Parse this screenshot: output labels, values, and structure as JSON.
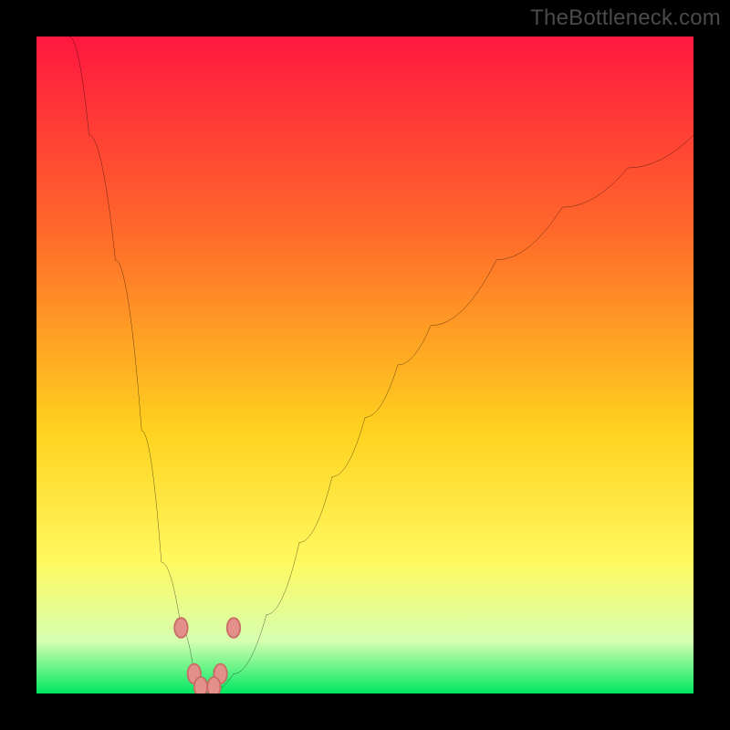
{
  "watermark": "TheBottleneck.com",
  "colors": {
    "page_bg": "#000000",
    "gradient_top": "#ff173f",
    "gradient_mid1": "#ff6a2a",
    "gradient_mid2": "#ffd21f",
    "gradient_mid3": "#fff960",
    "gradient_bottom_light": "#d6ffb0",
    "gradient_bottom": "#00e862",
    "curve": "#000000",
    "marker_fill": "#e4908a",
    "marker_stroke": "#c86b64",
    "watermark": "#4a4a4a"
  },
  "chart_data": {
    "type": "line",
    "title": "",
    "xlabel": "",
    "ylabel": "",
    "xlim": [
      0,
      100
    ],
    "ylim": [
      0,
      100
    ],
    "grid": false,
    "legend": false,
    "background_gradient": [
      {
        "y": 100,
        "color": "#ff173f"
      },
      {
        "y": 70,
        "color": "#ff6a2a"
      },
      {
        "y": 40,
        "color": "#ffd21f"
      },
      {
        "y": 20,
        "color": "#fff960"
      },
      {
        "y": 8,
        "color": "#d6ffb0"
      },
      {
        "y": 0,
        "color": "#00e862"
      }
    ],
    "series": [
      {
        "name": "curve",
        "x": [
          5,
          8,
          12,
          16,
          19,
          22,
          24,
          26,
          30,
          35,
          40,
          45,
          50,
          55,
          60,
          70,
          80,
          90,
          100
        ],
        "y": [
          100,
          85,
          66,
          40,
          20,
          10,
          3,
          0,
          3,
          12,
          23,
          33,
          42,
          50,
          56,
          66,
          74,
          80,
          85
        ]
      }
    ],
    "markers": [
      {
        "x": 22,
        "y": 10
      },
      {
        "x": 30,
        "y": 10
      },
      {
        "x": 24,
        "y": 3
      },
      {
        "x": 28,
        "y": 3
      },
      {
        "x": 25,
        "y": 1
      },
      {
        "x": 27,
        "y": 1
      }
    ]
  }
}
